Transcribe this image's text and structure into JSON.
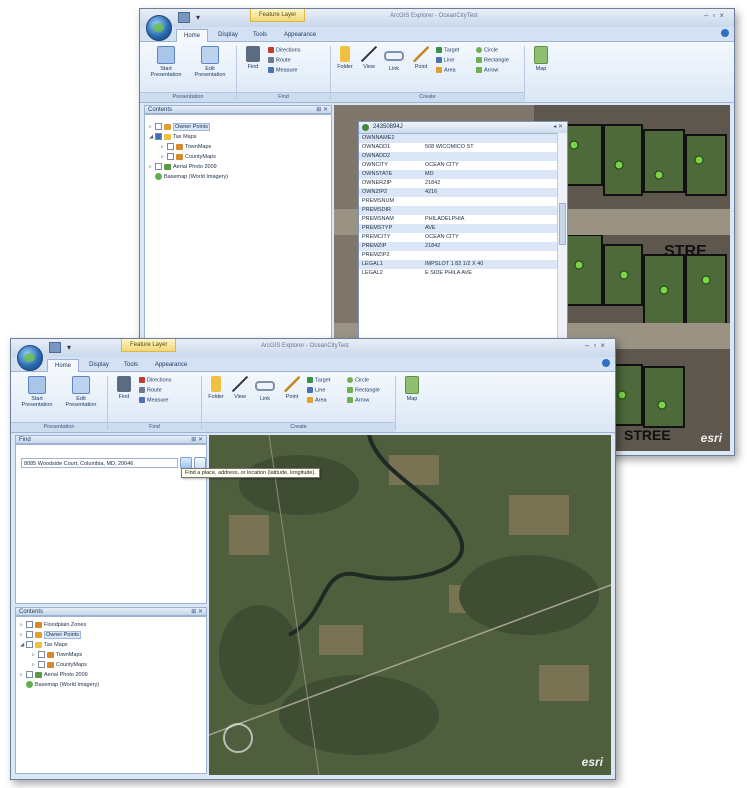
{
  "back_window": {
    "title": "ArcGIS Explorer - OceanCityTest",
    "context_tab": "Feature Layer",
    "tabs": [
      "Home",
      "Display",
      "Tools",
      "Appearance"
    ],
    "ribbon": {
      "start_presentation": "Start Presentation",
      "edit_presentation": "Edit Presentation",
      "find": "Find",
      "directions": "Directions",
      "route": "Route",
      "measure": "Measure",
      "folder": "Folder",
      "view": "View",
      "link": "Link",
      "point": "Point",
      "target": "Target",
      "line": "Line",
      "area": "Area",
      "circle": "Circle",
      "rectangle": "Rectangle",
      "arrow": "Arrow",
      "map": "Map",
      "group_presentation": "Presentation",
      "group_find": "Find",
      "group_create": "Create"
    },
    "contents": {
      "header": "Contents",
      "items": [
        {
          "label": "Owner Points",
          "selected": true
        },
        {
          "label": "Tax Maps"
        },
        {
          "label": "TownMaps"
        },
        {
          "label": "CountyMaps"
        },
        {
          "label": "Aerial Photo 2009"
        },
        {
          "label": "Basemap (World Imagery)"
        }
      ]
    },
    "popup": {
      "title": "24350894J",
      "attributes": [
        {
          "key": "OWNNAME2",
          "value": ""
        },
        {
          "key": "OWNADD1",
          "value": "508 WICOMICO ST"
        },
        {
          "key": "OWNADD2",
          "value": ""
        },
        {
          "key": "OWNCITY",
          "value": "OCEAN CITY"
        },
        {
          "key": "OWNSTATE",
          "value": "MD"
        },
        {
          "key": "OWNERZIP",
          "value": "21842"
        },
        {
          "key": "OWNZIP2",
          "value": "4216"
        },
        {
          "key": "PREMSNUM",
          "value": ""
        },
        {
          "key": "PREMSDIR",
          "value": ""
        },
        {
          "key": "PREMSNAM",
          "value": "PHILADELPHIA"
        },
        {
          "key": "PREMSTYP",
          "value": "AVE"
        },
        {
          "key": "PREMCITY",
          "value": "OCEAN CITY"
        },
        {
          "key": "PREMZIP",
          "value": "21842"
        },
        {
          "key": "PREMZIP2",
          "value": ""
        },
        {
          "key": "LEGAL1",
          "value": "IMPSLOT 1 82 1/2 X 40"
        },
        {
          "key": "LEGAL2",
          "value": "E SIDE PHILA AVE"
        }
      ]
    },
    "map_labels": {
      "street1": "STRE",
      "street2": "STREE",
      "esri": "esri"
    }
  },
  "front_window": {
    "title": "ArcGIS Explorer - OceanCityTest",
    "context_tab": "Feature Layer",
    "tabs": [
      "Home",
      "Display",
      "Tools",
      "Appearance"
    ],
    "find_panel": {
      "header": "Find",
      "search_value": "8085 Woodside Court, Columbia, MD, 20046",
      "tooltip": "Find a place, address, or location (latitude, longitude)."
    },
    "contents": {
      "header": "Contents",
      "items": [
        {
          "label": "Floodplain Zones"
        },
        {
          "label": "Owner Points",
          "selected": true
        },
        {
          "label": "Tax Maps"
        },
        {
          "label": "TownMaps"
        },
        {
          "label": "CountyMaps"
        },
        {
          "label": "Aerial Photo 2009"
        },
        {
          "label": "Basemap (World Imagery)"
        }
      ]
    },
    "map_labels": {
      "esri": "esri"
    }
  }
}
